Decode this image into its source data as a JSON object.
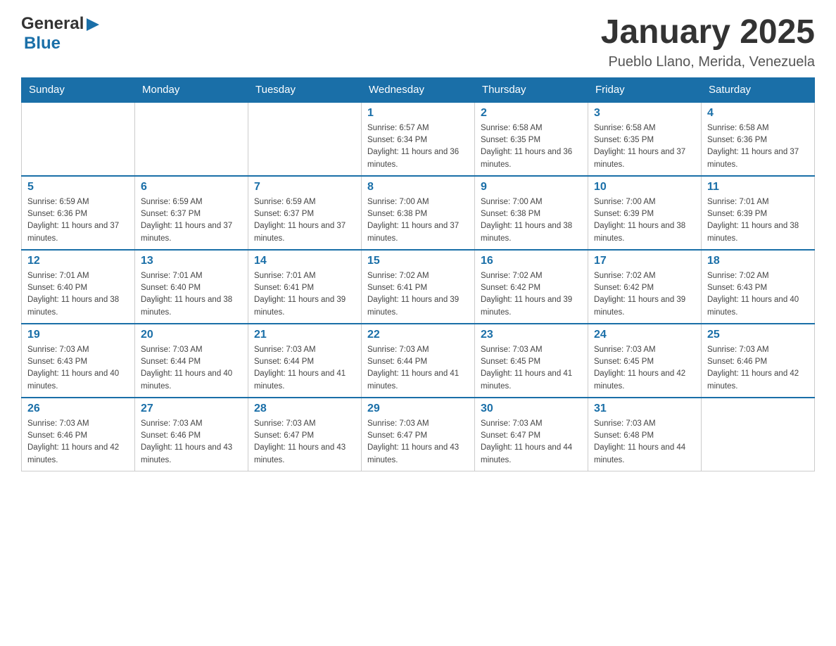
{
  "header": {
    "logo_general": "General",
    "logo_blue": "Blue",
    "title": "January 2025",
    "location": "Pueblo Llano, Merida, Venezuela"
  },
  "days_of_week": [
    "Sunday",
    "Monday",
    "Tuesday",
    "Wednesday",
    "Thursday",
    "Friday",
    "Saturday"
  ],
  "weeks": [
    {
      "cells": [
        {
          "day": "",
          "info": ""
        },
        {
          "day": "",
          "info": ""
        },
        {
          "day": "",
          "info": ""
        },
        {
          "day": "1",
          "info": "Sunrise: 6:57 AM\nSunset: 6:34 PM\nDaylight: 11 hours and 36 minutes."
        },
        {
          "day": "2",
          "info": "Sunrise: 6:58 AM\nSunset: 6:35 PM\nDaylight: 11 hours and 36 minutes."
        },
        {
          "day": "3",
          "info": "Sunrise: 6:58 AM\nSunset: 6:35 PM\nDaylight: 11 hours and 37 minutes."
        },
        {
          "day": "4",
          "info": "Sunrise: 6:58 AM\nSunset: 6:36 PM\nDaylight: 11 hours and 37 minutes."
        }
      ]
    },
    {
      "cells": [
        {
          "day": "5",
          "info": "Sunrise: 6:59 AM\nSunset: 6:36 PM\nDaylight: 11 hours and 37 minutes."
        },
        {
          "day": "6",
          "info": "Sunrise: 6:59 AM\nSunset: 6:37 PM\nDaylight: 11 hours and 37 minutes."
        },
        {
          "day": "7",
          "info": "Sunrise: 6:59 AM\nSunset: 6:37 PM\nDaylight: 11 hours and 37 minutes."
        },
        {
          "day": "8",
          "info": "Sunrise: 7:00 AM\nSunset: 6:38 PM\nDaylight: 11 hours and 37 minutes."
        },
        {
          "day": "9",
          "info": "Sunrise: 7:00 AM\nSunset: 6:38 PM\nDaylight: 11 hours and 38 minutes."
        },
        {
          "day": "10",
          "info": "Sunrise: 7:00 AM\nSunset: 6:39 PM\nDaylight: 11 hours and 38 minutes."
        },
        {
          "day": "11",
          "info": "Sunrise: 7:01 AM\nSunset: 6:39 PM\nDaylight: 11 hours and 38 minutes."
        }
      ]
    },
    {
      "cells": [
        {
          "day": "12",
          "info": "Sunrise: 7:01 AM\nSunset: 6:40 PM\nDaylight: 11 hours and 38 minutes."
        },
        {
          "day": "13",
          "info": "Sunrise: 7:01 AM\nSunset: 6:40 PM\nDaylight: 11 hours and 38 minutes."
        },
        {
          "day": "14",
          "info": "Sunrise: 7:01 AM\nSunset: 6:41 PM\nDaylight: 11 hours and 39 minutes."
        },
        {
          "day": "15",
          "info": "Sunrise: 7:02 AM\nSunset: 6:41 PM\nDaylight: 11 hours and 39 minutes."
        },
        {
          "day": "16",
          "info": "Sunrise: 7:02 AM\nSunset: 6:42 PM\nDaylight: 11 hours and 39 minutes."
        },
        {
          "day": "17",
          "info": "Sunrise: 7:02 AM\nSunset: 6:42 PM\nDaylight: 11 hours and 39 minutes."
        },
        {
          "day": "18",
          "info": "Sunrise: 7:02 AM\nSunset: 6:43 PM\nDaylight: 11 hours and 40 minutes."
        }
      ]
    },
    {
      "cells": [
        {
          "day": "19",
          "info": "Sunrise: 7:03 AM\nSunset: 6:43 PM\nDaylight: 11 hours and 40 minutes."
        },
        {
          "day": "20",
          "info": "Sunrise: 7:03 AM\nSunset: 6:44 PM\nDaylight: 11 hours and 40 minutes."
        },
        {
          "day": "21",
          "info": "Sunrise: 7:03 AM\nSunset: 6:44 PM\nDaylight: 11 hours and 41 minutes."
        },
        {
          "day": "22",
          "info": "Sunrise: 7:03 AM\nSunset: 6:44 PM\nDaylight: 11 hours and 41 minutes."
        },
        {
          "day": "23",
          "info": "Sunrise: 7:03 AM\nSunset: 6:45 PM\nDaylight: 11 hours and 41 minutes."
        },
        {
          "day": "24",
          "info": "Sunrise: 7:03 AM\nSunset: 6:45 PM\nDaylight: 11 hours and 42 minutes."
        },
        {
          "day": "25",
          "info": "Sunrise: 7:03 AM\nSunset: 6:46 PM\nDaylight: 11 hours and 42 minutes."
        }
      ]
    },
    {
      "cells": [
        {
          "day": "26",
          "info": "Sunrise: 7:03 AM\nSunset: 6:46 PM\nDaylight: 11 hours and 42 minutes."
        },
        {
          "day": "27",
          "info": "Sunrise: 7:03 AM\nSunset: 6:46 PM\nDaylight: 11 hours and 43 minutes."
        },
        {
          "day": "28",
          "info": "Sunrise: 7:03 AM\nSunset: 6:47 PM\nDaylight: 11 hours and 43 minutes."
        },
        {
          "day": "29",
          "info": "Sunrise: 7:03 AM\nSunset: 6:47 PM\nDaylight: 11 hours and 43 minutes."
        },
        {
          "day": "30",
          "info": "Sunrise: 7:03 AM\nSunset: 6:47 PM\nDaylight: 11 hours and 44 minutes."
        },
        {
          "day": "31",
          "info": "Sunrise: 7:03 AM\nSunset: 6:48 PM\nDaylight: 11 hours and 44 minutes."
        },
        {
          "day": "",
          "info": ""
        }
      ]
    }
  ]
}
